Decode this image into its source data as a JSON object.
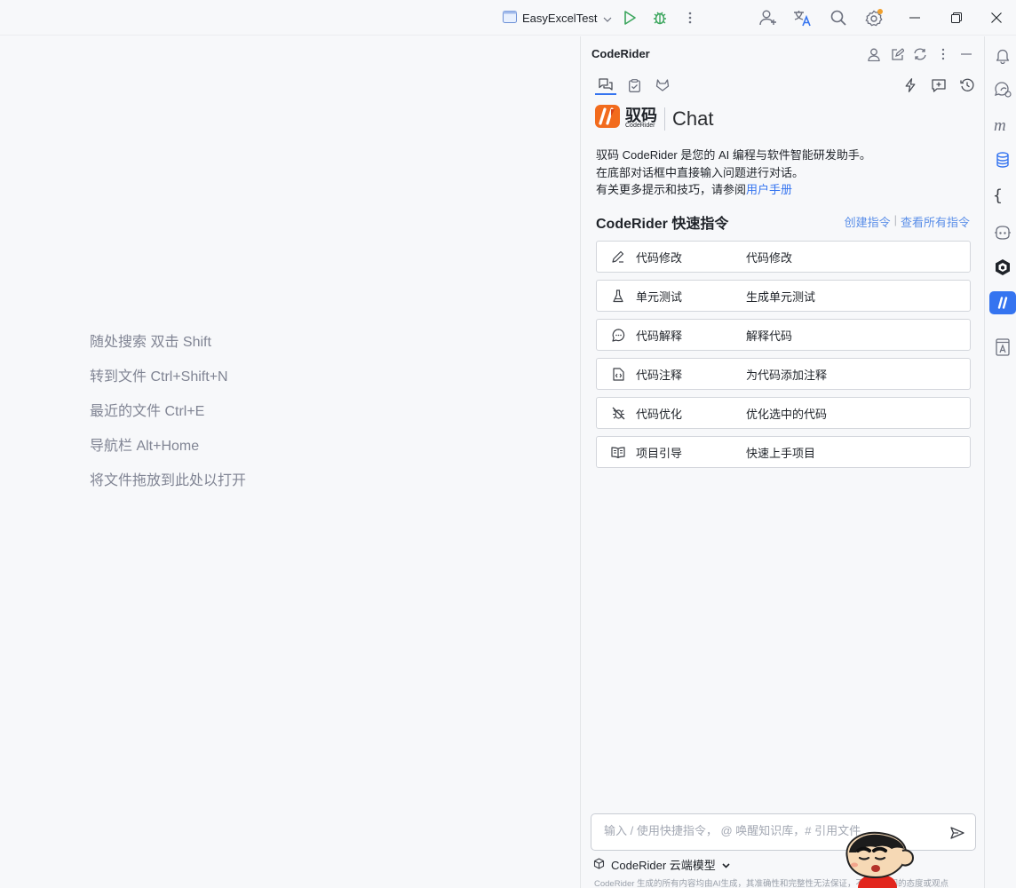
{
  "titlebar": {
    "project_name": "EasyExcelTest",
    "icons": [
      "project-window-icon",
      "run-icon",
      "debug-icon",
      "more-vertical-icon",
      "add-user-icon",
      "translate-icon",
      "search-icon",
      "settings-icon"
    ],
    "window_controls": [
      "minimize-icon",
      "restore-icon",
      "close-icon"
    ]
  },
  "editor_hints": [
    "随处搜索 双击 Shift",
    "转到文件 Ctrl+Shift+N",
    "最近的文件 Ctrl+E",
    "导航栏 Alt+Home",
    "将文件拖放到此处以打开"
  ],
  "panel": {
    "title": "CodeRider",
    "header_icons": [
      "account-icon",
      "edit-icon",
      "refresh-icon",
      "more-vertical-icon",
      "minimize-icon"
    ],
    "tabs": [
      "chat-tab-icon",
      "clipboard-tab-icon",
      "gitlab-tab-icon"
    ],
    "tab_actions": [
      "flash-icon",
      "new-chat-icon",
      "history-icon"
    ],
    "brand": {
      "name_cn": "驭码",
      "name_en": "CodeRider",
      "chat": "Chat"
    },
    "intro": {
      "line1": "驭码 CodeRider 是您的 AI 编程与软件智能研发助手。",
      "line2": "在底部对话框中直接输入问题进行对话。",
      "line3_prefix": "有关更多提示和技巧，请参阅",
      "line3_link": "用户手册"
    },
    "quick_commands_title": "CodeRider 快速指令",
    "create_command": "创建指令",
    "view_all_commands": "查看所有指令",
    "commands": [
      {
        "icon": "pencil-icon",
        "name": "代码修改",
        "desc": "代码修改"
      },
      {
        "icon": "flask-icon",
        "name": "单元测试",
        "desc": "生成单元测试"
      },
      {
        "icon": "chat-bubble-icon",
        "name": "代码解释",
        "desc": "解释代码"
      },
      {
        "icon": "document-icon",
        "name": "代码注释",
        "desc": "为代码添加注释"
      },
      {
        "icon": "bug-off-icon",
        "name": "代码优化",
        "desc": "优化选中的代码"
      },
      {
        "icon": "book-icon",
        "name": "项目引导",
        "desc": "快速上手项目"
      }
    ],
    "input_placeholder": "输入 / 使用快捷指令， @ 唤醒知识库，# 引用文件",
    "model_label": "CodeRider 云端模型",
    "disclaimer": "CodeRider 生成的所有内容均由AI生成，其准确性和完整性无法保证，不代表我们的态度或观点"
  },
  "right_strip": [
    "notifications-icon",
    "ai-chat-icon",
    "maven-icon",
    "database-icon",
    "json-icon",
    "copilot-icon",
    "tabnine-icon",
    "coderider-icon",
    "api-icon"
  ],
  "colors": {
    "accent": "#3574f0",
    "link": "#5a8ee8",
    "brand_orange": "#f26b1d",
    "run_green": "#3aa55c",
    "coderider_blue": "#3574f0"
  }
}
